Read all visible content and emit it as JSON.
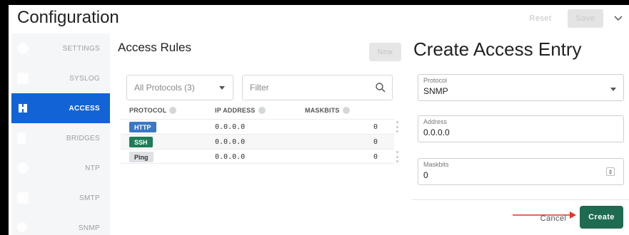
{
  "header": {
    "title": "Configuration",
    "reset_label": "Reset",
    "save_label": "Save",
    "chevron_icon": "chevron-down-icon"
  },
  "sidebar": {
    "items": [
      {
        "label": "SETTINGS",
        "icon": "gear-icon"
      },
      {
        "label": "SYSLOG",
        "icon": "document-icon"
      },
      {
        "label": "ACCESS",
        "icon": "access-icon",
        "active": true
      },
      {
        "label": "BRIDGES",
        "icon": "bridge-icon"
      },
      {
        "label": "NTP",
        "icon": "clock-icon"
      },
      {
        "label": "SMTP",
        "icon": "mail-icon"
      },
      {
        "label": "SNMP",
        "icon": "network-icon"
      }
    ],
    "active_color": "#1264d6"
  },
  "rules": {
    "title": "Access Rules",
    "new_label": "New",
    "protocol_filter": "All Protocols (3)",
    "filter_placeholder": "Filter",
    "columns": {
      "protocol": "PROTOCOL",
      "ip": "IP ADDRESS",
      "mask": "MASKBITS"
    },
    "rows": [
      {
        "protocol": "HTTP",
        "badge_bg": "#3a78c4",
        "badge_fg": "#ffffff",
        "ip": "0.0.0.0",
        "mask": "0",
        "menu": true
      },
      {
        "protocol": "SSH",
        "badge_bg": "#1e7d57",
        "badge_fg": "#ffffff",
        "ip": "0.0.0.0",
        "mask": "0",
        "menu": false
      },
      {
        "protocol": "Ping",
        "badge_bg": "#dfe1e4",
        "badge_fg": "#333333",
        "ip": "0.0.0.0",
        "mask": "0",
        "menu": true
      }
    ]
  },
  "create": {
    "title": "Create Access Entry",
    "protocol_label": "Protocol",
    "protocol_value": "SNMP",
    "address_label": "Address",
    "address_value": "0.0.0.0",
    "maskbits_label": "Maskbits",
    "maskbits_value": "0",
    "cancel_label": "Cancel",
    "create_label": "Create",
    "create_color": "#1e6b52",
    "arrow_color": "#e0342a"
  }
}
